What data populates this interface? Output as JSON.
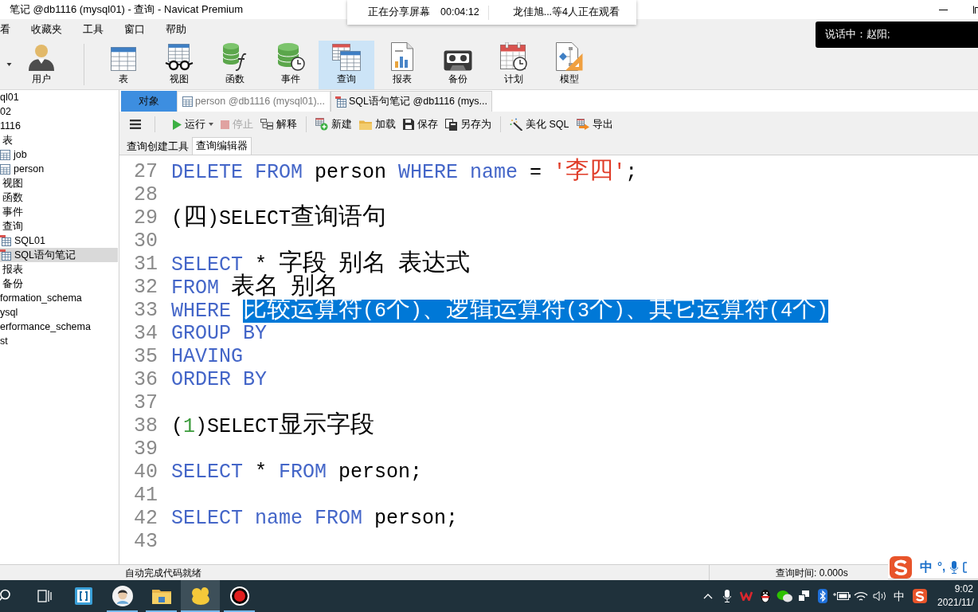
{
  "window": {
    "title": "笔记 @db1116 (mysql01) - 查询 - Navicat Premium"
  },
  "screen_share": {
    "status": "正在分享屏幕",
    "timer": "00:04:12",
    "viewers": "龙佳旭...等4人正在观看"
  },
  "speaking_banner": {
    "text": "说话中：赵阳;"
  },
  "menu": [
    "看",
    "收藏夹",
    "工具",
    "窗口",
    "帮助"
  ],
  "ribbon": [
    {
      "kind": "user",
      "label": "用户",
      "selected": false
    },
    {
      "kind": "table",
      "label": "表",
      "selected": false
    },
    {
      "kind": "view",
      "label": "视图",
      "selected": false
    },
    {
      "kind": "function",
      "label": "函数",
      "selected": false
    },
    {
      "kind": "event",
      "label": "事件",
      "selected": false
    },
    {
      "kind": "query",
      "label": "查询",
      "selected": true
    },
    {
      "kind": "report",
      "label": "报表",
      "selected": false
    },
    {
      "kind": "backup",
      "label": "备份",
      "selected": false
    },
    {
      "kind": "schedule",
      "label": "计划",
      "selected": false
    },
    {
      "kind": "model",
      "label": "模型",
      "selected": false
    }
  ],
  "sidebar": {
    "items": [
      {
        "label": "ql01",
        "selected": false
      },
      {
        "label": "02",
        "selected": false
      },
      {
        "label": "1116",
        "selected": false,
        "children": [
          {
            "label": "表",
            "selected": false,
            "children": [
              {
                "kind": "table",
                "label": "job",
                "selected": false
              },
              {
                "kind": "table",
                "label": "person",
                "selected": false
              }
            ]
          },
          {
            "label": "视图",
            "selected": false
          },
          {
            "label": "函数",
            "selected": false
          },
          {
            "label": "事件",
            "selected": false
          },
          {
            "label": "查询",
            "selected": false,
            "children": [
              {
                "kind": "query",
                "label": "SQL01",
                "selected": false
              },
              {
                "kind": "query",
                "label": "SQL语句笔记",
                "selected": true
              }
            ]
          },
          {
            "label": "报表",
            "selected": false
          },
          {
            "label": "备份",
            "selected": false
          }
        ]
      },
      {
        "label": "formation_schema",
        "selected": false
      },
      {
        "label": "ysql",
        "selected": false
      },
      {
        "label": "erformance_schema",
        "selected": false
      },
      {
        "label": "st",
        "selected": false
      }
    ]
  },
  "tabs": [
    {
      "kind": "objects",
      "label": "对象",
      "selected": false
    },
    {
      "kind": "table",
      "label": "person @db1116 (mysql01)...",
      "selected": false
    },
    {
      "kind": "query",
      "label": "SQL语句笔记 @db1116 (mys...",
      "selected": true
    }
  ],
  "toolbar": {
    "groups": [
      {
        "items": [
          {
            "kind": "menu",
            "disabled": false
          }
        ]
      },
      {
        "items": [
          {
            "kind": "run",
            "label": "运行",
            "disabled": false
          },
          {
            "kind": "stop",
            "label": "停止",
            "disabled": true
          },
          {
            "kind": "explain",
            "label": "解释",
            "disabled": false
          }
        ]
      },
      {
        "items": [
          {
            "kind": "new",
            "label": "新建",
            "disabled": false
          },
          {
            "kind": "load",
            "label": "加载",
            "disabled": false
          },
          {
            "kind": "save",
            "label": "保存",
            "disabled": false
          },
          {
            "kind": "save_as",
            "label": "另存为",
            "disabled": false
          }
        ]
      },
      {
        "items": [
          {
            "kind": "beautify",
            "label": "美化 SQL",
            "disabled": false
          },
          {
            "kind": "export",
            "label": "导出",
            "disabled": false
          }
        ]
      }
    ]
  },
  "editor_tabs": [
    {
      "label": "查询创建工具",
      "selected": false
    },
    {
      "label": "查询编辑器",
      "selected": true
    }
  ],
  "editor": {
    "lines": [
      {
        "number": "27",
        "tokens": [
          {
            "kind": "keyword",
            "text": "DELETE FROM",
            "selected": false
          },
          {
            "kind": "plain",
            "text": " person ",
            "selected": false
          },
          {
            "kind": "keyword",
            "text": "WHERE name",
            "selected": false
          },
          {
            "kind": "plain",
            "text": " = ",
            "selected": false
          },
          {
            "kind": "string",
            "text": "'李四'",
            "selected": false
          },
          {
            "kind": "plain",
            "text": ";",
            "selected": false
          }
        ]
      },
      {
        "number": "28"
      },
      {
        "number": "29",
        "tokens": [
          {
            "kind": "plain",
            "text": "(四)SELECT查询语句",
            "selected": false
          }
        ]
      },
      {
        "number": "30"
      },
      {
        "number": "31",
        "tokens": [
          {
            "kind": "keyword",
            "text": "SELECT",
            "selected": false
          },
          {
            "kind": "plain",
            "text": " * 字段 别名 表达式",
            "selected": false
          }
        ]
      },
      {
        "number": "32",
        "tokens": [
          {
            "kind": "keyword",
            "text": "FROM",
            "selected": false
          },
          {
            "kind": "plain",
            "text": " 表名 别名",
            "selected": false
          }
        ]
      },
      {
        "number": "33",
        "tokens": [
          {
            "kind": "keyword",
            "text": "WHERE ",
            "selected": false
          },
          {
            "text": "比较运算符(6个)、逻辑运算符(3个)、其它运算符(4个)",
            "selected": true
          }
        ]
      },
      {
        "number": "34",
        "tokens": [
          {
            "kind": "keyword",
            "text": "GROUP BY",
            "selected": false
          }
        ]
      },
      {
        "number": "35",
        "tokens": [
          {
            "kind": "keyword",
            "text": "HAVING",
            "selected": false
          }
        ]
      },
      {
        "number": "36",
        "tokens": [
          {
            "kind": "keyword",
            "text": "ORDER BY",
            "selected": false
          }
        ]
      },
      {
        "number": "37"
      },
      {
        "number": "38",
        "tokens": [
          {
            "kind": "plain",
            "text": "(",
            "selected": false
          },
          {
            "kind": "number",
            "text": "1",
            "selected": false
          },
          {
            "kind": "plain",
            "text": ")SELECT显示字段",
            "selected": false
          }
        ]
      },
      {
        "number": "39"
      },
      {
        "number": "40",
        "tokens": [
          {
            "kind": "keyword",
            "text": "SELECT",
            "selected": false
          },
          {
            "kind": "plain",
            "text": " * ",
            "selected": false
          },
          {
            "kind": "keyword",
            "text": "FROM",
            "selected": false
          },
          {
            "kind": "plain",
            "text": " person;",
            "selected": false
          }
        ]
      },
      {
        "number": "41"
      },
      {
        "number": "42",
        "tokens": [
          {
            "kind": "keyword",
            "text": "SELECT name FROM",
            "selected": false
          },
          {
            "kind": "plain",
            "text": " person;",
            "selected": false
          }
        ]
      },
      {
        "number": "43"
      }
    ]
  },
  "status_bar": {
    "message": "自动完成代码就绪",
    "query_time": "查询时间: 0.000s"
  },
  "ime_toolbar": {
    "mode": "中",
    "punctuation": "°,"
  },
  "taskbar": {
    "apps": [
      {
        "kind": "code_editor",
        "running": false,
        "selected": false
      },
      {
        "kind": "avatar",
        "running": true,
        "selected": false
      },
      {
        "kind": "folder",
        "running": true,
        "selected": false
      },
      {
        "kind": "database_app",
        "running": true,
        "selected": true
      },
      {
        "kind": "recorder",
        "running": true,
        "selected": false
      }
    ],
    "tray": {
      "input_mode": "中",
      "time": "9:02",
      "date": "2021/11/"
    }
  }
}
